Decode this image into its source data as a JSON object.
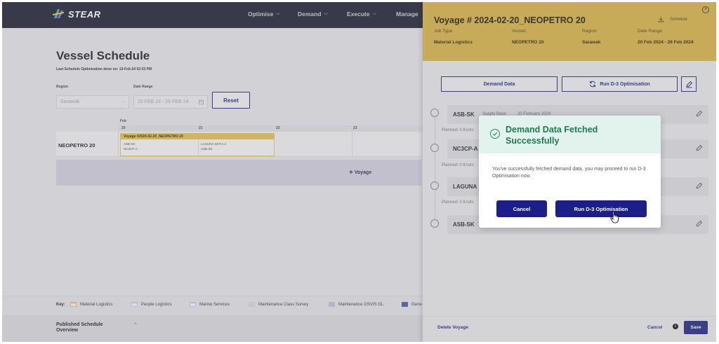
{
  "app": {
    "logo_text": "STEAR"
  },
  "nav": {
    "items": [
      "Optimise",
      "Demand",
      "Execute",
      "Manage"
    ]
  },
  "page": {
    "title": "Vessel Schedule",
    "last_optimisation": "Last Schedule Optimisation done on: 13-Feb-24 02:33 PM",
    "region_label": "Region",
    "region_value": "Sarawak",
    "date_range_label": "Date Range",
    "date_range_value": "20 FEB 24 - 26 FEB 24",
    "reset_label": "Reset"
  },
  "calendar": {
    "month": "Feb",
    "days": [
      "20",
      "21",
      "22",
      "23"
    ],
    "vessel": "NEOPETRO 20",
    "voyage_card": {
      "title": "Voyage #2024-02-20_NEOPETRO 20",
      "col1": [
        "ASB-SK",
        "NC3CP-A"
      ],
      "col2": [
        "LAGUNA SETIA 2",
        "ASB-SK"
      ]
    },
    "add_voyage": "Voyage"
  },
  "key": {
    "label": "Key:",
    "items": [
      {
        "label": "Material Logistics",
        "color": "#e3c35e"
      },
      {
        "label": "People Logistics",
        "color": "#c9cbe6"
      },
      {
        "label": "Marine Services",
        "color": "#b7d0e8"
      },
      {
        "label": "Maintenance Class Survey",
        "color": "#d7d7dc"
      },
      {
        "label": "Maintenance OSVIS GL",
        "color": "#c5c1d8"
      },
      {
        "label": "Gene",
        "color": "#5b5fa3"
      }
    ]
  },
  "published": {
    "label_line1": "Published Schedule",
    "label_line2": "Overview"
  },
  "panel": {
    "title": "Voyage # 2024-02-20_NEOPETRO 20",
    "schedule_label": "Schedule",
    "meta": [
      {
        "label": "Job Type:",
        "value": "Material Logistics"
      },
      {
        "label": "Vessel:",
        "value": "NEOPETRO 20"
      },
      {
        "label": "Region:",
        "value": "Sarawak"
      },
      {
        "label": "Date Range:",
        "value": "20 Feb 2024 - 26 Feb 2024"
      }
    ],
    "demand_data_label": "Demand Data",
    "run_optimisation_label": "Run D-3 Optimisation",
    "stops": [
      {
        "name": "ASB-SK",
        "tag": "Supply Base",
        "date": "20 February 2024",
        "planned": "Planned: 0 Knots"
      },
      {
        "name": "NC3CP-A",
        "planned": "Planned: 0 Knots"
      },
      {
        "name": "LAGUNA",
        "planned": "Planned: 0 Knots"
      },
      {
        "name": "ASB-SK"
      }
    ],
    "delete_voyage": "Delete Voyage",
    "cancel": "Cancel",
    "save": "Save"
  },
  "modal": {
    "title": "Demand Data Fetched Successfully",
    "body": "You've successfully fetched demand data, you may proceed to run D-3 Optimisation now.",
    "cancel_label": "Cancel",
    "run_label": "Run D-3 Optimisation",
    "accent": "#1e7a54",
    "button_color": "#1c1f8a"
  }
}
